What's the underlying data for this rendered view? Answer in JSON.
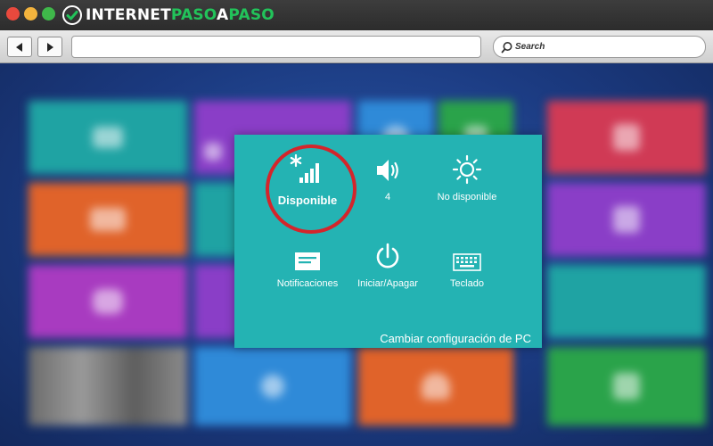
{
  "logo": {
    "part1": "INTERNET",
    "part2": "PASO",
    "part3": "A",
    "part4": "PASO"
  },
  "toolbar": {
    "back_label": "Back",
    "forward_label": "Forward",
    "url": "",
    "search_placeholder": "Search"
  },
  "settings": {
    "network_label": "Disponible",
    "volume_label": "4",
    "brightness_label": "No disponible",
    "notifications_label": "Notificaciones",
    "power_label": "Iniciar/Apagar",
    "keyboard_label": "Teclado",
    "change_settings_label": "Cambiar configuración de PC"
  },
  "colors": {
    "panel": "#24b3b3",
    "highlight_ring": "#d4252b",
    "brand_green": "#22c35a"
  }
}
